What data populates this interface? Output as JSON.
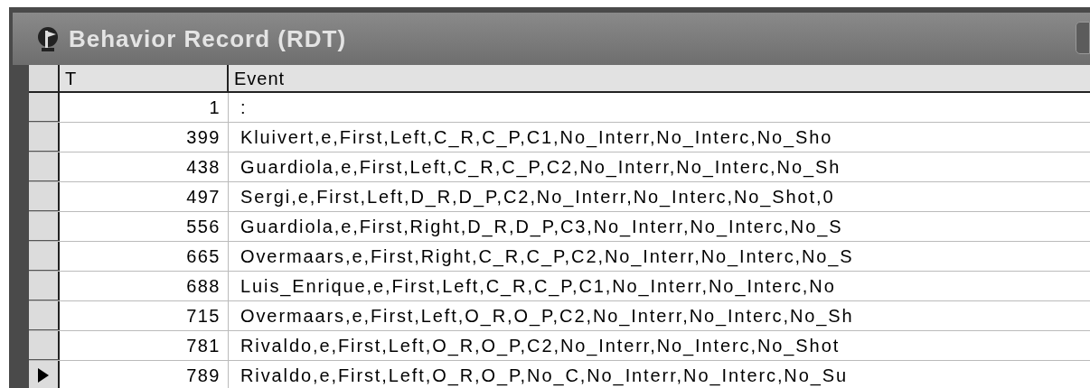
{
  "window": {
    "title": "Behavior Record (RDT)"
  },
  "table": {
    "columns": [
      "T",
      "Event"
    ],
    "rows": [
      {
        "t": "1",
        "event": ":",
        "selected": false
      },
      {
        "t": "399",
        "event": "Kluivert,e,First,Left,C_R,C_P,C1,No_Interr,No_Interc,No_Sho",
        "selected": false
      },
      {
        "t": "438",
        "event": "Guardiola,e,First,Left,C_R,C_P,C2,No_Interr,No_Interc,No_Sh",
        "selected": false
      },
      {
        "t": "497",
        "event": "Sergi,e,First,Left,D_R,D_P,C2,No_Interr,No_Interc,No_Shot,0",
        "selected": false
      },
      {
        "t": "556",
        "event": "Guardiola,e,First,Right,D_R,D_P,C3,No_Interr,No_Interc,No_S",
        "selected": false
      },
      {
        "t": "665",
        "event": "Overmaars,e,First,Right,C_R,C_P,C2,No_Interr,No_Interc,No_S",
        "selected": false
      },
      {
        "t": "688",
        "event": "Luis_Enrique,e,First,Left,C_R,C_P,C1,No_Interr,No_Interc,No",
        "selected": false
      },
      {
        "t": "715",
        "event": "Overmaars,e,First,Left,O_R,O_P,C2,No_Interr,No_Interc,No_Sh",
        "selected": false
      },
      {
        "t": "781",
        "event": "Rivaldo,e,First,Left,O_R,O_P,C2,No_Interr,No_Interc,No_Shot",
        "selected": false
      },
      {
        "t": "789",
        "event": "Rivaldo,e,First,Left,O_R,O_P,No_C,No_Interr,No_Interc,No_Su",
        "selected": true
      }
    ]
  }
}
